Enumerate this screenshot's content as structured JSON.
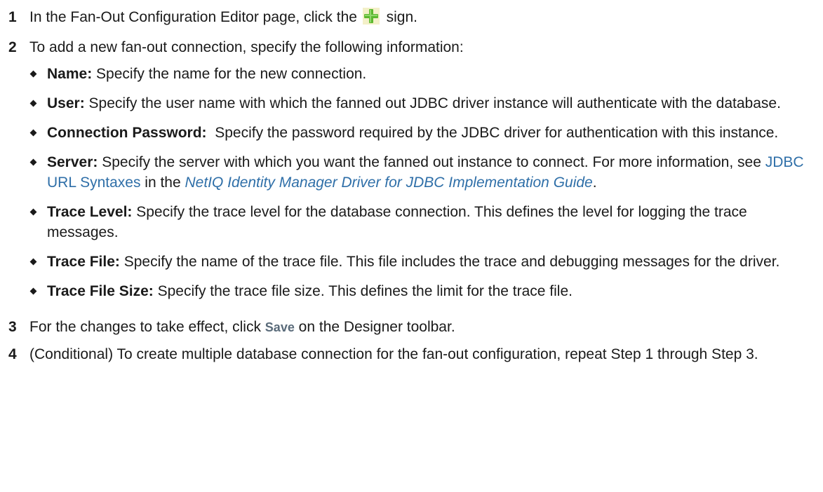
{
  "steps": [
    {
      "num": "1",
      "before": "In the Fan-Out Configuration Editor page, click the",
      "icon": "plus-icon",
      "after": "sign."
    },
    {
      "num": "2",
      "text": "To add a new fan-out connection, specify the following information:",
      "bullets": [
        {
          "term": "Name:",
          "text": " Specify the name for the new connection."
        },
        {
          "term": "User:",
          "text": " Specify the user name with which the fanned out JDBC driver instance will authenticate with the database."
        },
        {
          "term": "Connection Password:",
          "text": "  Specify the password required by the JDBC driver for authentication with this instance."
        },
        {
          "term": "Server:",
          "text": " Specify the server with which you want the fanned out instance to connect. For more information, see ",
          "link": "JDBC URL Syntaxes",
          "mid": " in the ",
          "guide": "NetIQ Identity Manager Driver for JDBC Implementation Guide",
          "end": "."
        },
        {
          "term": "Trace Level:",
          "text": " Specify the trace level for the database connection. This defines the level for logging the trace messages."
        },
        {
          "term": "Trace File:",
          "text": " Specify the name of the trace file. This file includes the trace and debugging messages for the driver."
        },
        {
          "term": "Trace File Size:",
          "text": " Specify the trace file size. This defines the limit for the trace file."
        }
      ]
    },
    {
      "num": "3",
      "before": "For the changes to take effect, click ",
      "ui": "Save",
      "after": " on the Designer toolbar."
    },
    {
      "num": "4",
      "text": "(Conditional) To create multiple database connection for the fan-out configuration, repeat Step 1 through Step 3."
    }
  ],
  "colors": {
    "text": "#1a1a1a",
    "link": "#2f6fa8",
    "ui_label": "#5a6b7a",
    "plus_icon_green": "#5cb82e",
    "plus_icon_bg": "#f3f0c8"
  }
}
